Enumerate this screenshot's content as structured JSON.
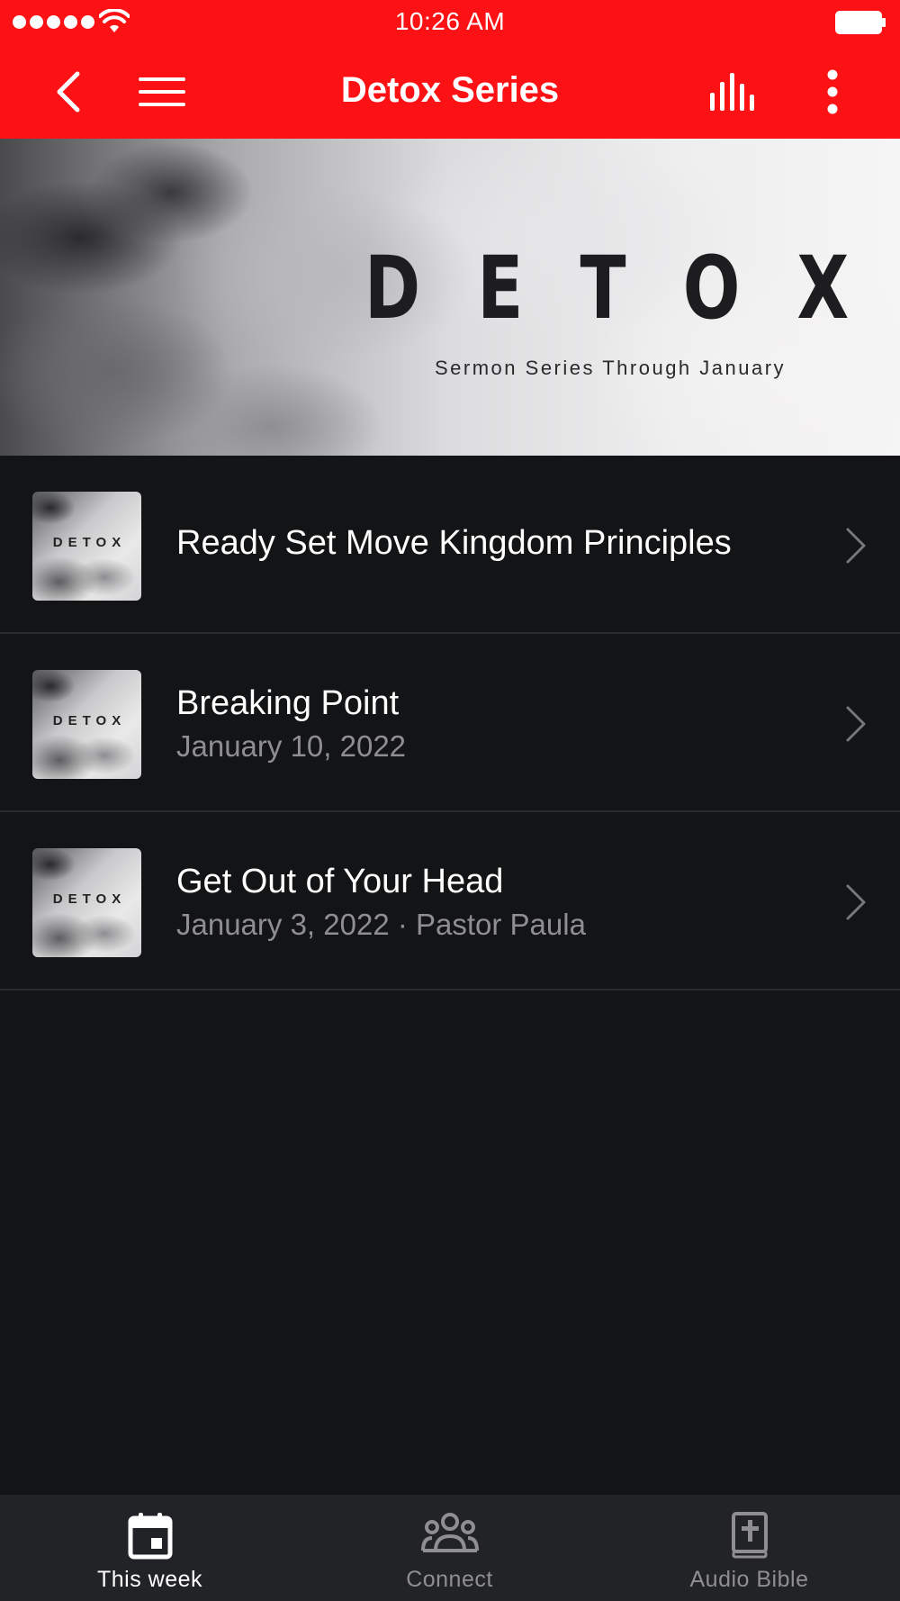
{
  "status_bar": {
    "time": "10:26 AM",
    "icons": [
      "signal-dots-icon",
      "wifi-icon",
      "battery-icon"
    ]
  },
  "nav": {
    "title": "Detox Series",
    "icons": [
      "back-chevron-icon",
      "hamburger-menu-icon",
      "equalizer-icon",
      "more-vertical-icon"
    ]
  },
  "banner": {
    "word": [
      "D",
      "E",
      "T",
      "O",
      "X"
    ],
    "subtitle": "Sermon Series Through January"
  },
  "sermons": [
    {
      "title": "Ready Set Move Kingdom Principles",
      "subtitle": "",
      "thumb_text": "DETOX"
    },
    {
      "title": "Breaking Point",
      "subtitle": "January 10, 2022",
      "thumb_text": "DETOX"
    },
    {
      "title": "Get Out of Your Head",
      "subtitle": "January 3, 2022 · Pastor Paula",
      "thumb_text": "DETOX"
    }
  ],
  "tabs": [
    {
      "label": "This week",
      "icon": "calendar-icon",
      "active": true
    },
    {
      "label": "Connect",
      "icon": "people-group-icon",
      "active": false
    },
    {
      "label": "Audio Bible",
      "icon": "bible-book-icon",
      "active": false
    }
  ],
  "colors": {
    "header_red": "#fc1214",
    "background": "#131416",
    "tabbar": "#222326",
    "secondary_text": "#8e8e93"
  }
}
